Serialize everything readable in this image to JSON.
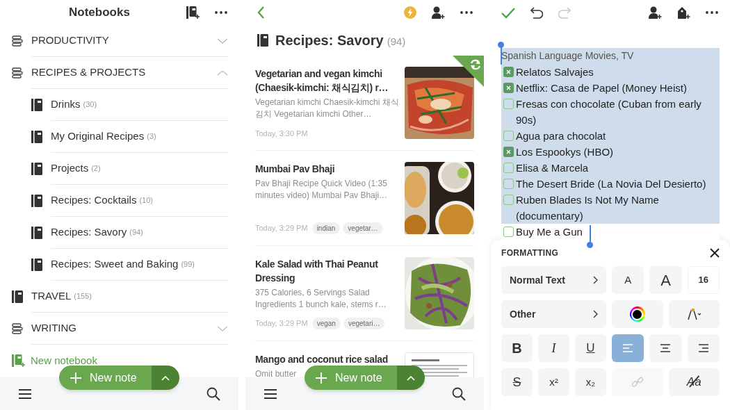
{
  "notebooks_screen": {
    "title": "Notebooks",
    "items": [
      {
        "kind": "stack",
        "label": "PRODUCTIVITY",
        "expanded": false
      },
      {
        "kind": "stack",
        "label": "RECIPES & PROJECTS",
        "expanded": true,
        "children": [
          {
            "label": "Drinks",
            "count": "(30)"
          },
          {
            "label": "My Original Recipes",
            "count": "(3)"
          },
          {
            "label": "Projects",
            "count": "(2)"
          },
          {
            "label": "Recipes: Cocktails",
            "count": "(10)"
          },
          {
            "label": "Recipes: Savory",
            "count": "(94)"
          },
          {
            "label": "Recipes: Sweet and Baking",
            "count": "(99)"
          }
        ]
      },
      {
        "kind": "notebook",
        "label": "TRAVEL",
        "count": "(155)"
      },
      {
        "kind": "stack",
        "label": "WRITING",
        "expanded": false
      }
    ],
    "new_notebook": "New notebook",
    "new_note": "New note"
  },
  "notes_screen": {
    "notebook": "Recipes: Savory",
    "count": "(94)",
    "new_note": "New note",
    "notes": [
      {
        "title": "Vegetarian and vegan kimchi (Chaesik-kimchi: 채식김치) r…",
        "snippet": "Vegetarian kimchi Chaesik-kimchi 채식김치 Vegetarian kimchi Other…",
        "date": "Today, 3:30 PM",
        "kind": "picture",
        "sync_badge": true
      },
      {
        "title": "Mumbai Pav Bhaji",
        "snippet": "Pav Bhaji Recipe Quick Video (1:35 minutes video) Mumbai Pav Bhaji…",
        "date": "Today, 3:29 PM",
        "tags": [
          "indian",
          "vegetar…"
        ],
        "kind": "picture",
        "sync_badge": false
      },
      {
        "title": "Kale Salad with Thai Peanut Dressing",
        "snippet": "375 Calories, 6 Servings Salad Ingredients 1 bunch kale, stems r…",
        "date": "Today, 3:29 PM",
        "tags": [
          "vegan",
          "vegetari…"
        ],
        "kind": "picture",
        "sync_badge": false
      },
      {
        "title": "Mango and coconut rice salad",
        "snippet": "Omit butter",
        "kind": "document",
        "sync_badge": false
      }
    ]
  },
  "editor_screen": {
    "redo_disabled": true,
    "items": [
      {
        "kind": "heading",
        "text": "Spanish Language Movies, TV",
        "selected": true
      },
      {
        "kind": "check",
        "text": "Relatos Salvajes",
        "checked": true,
        "selected": true
      },
      {
        "kind": "check",
        "text": "Netflix: Casa de Papel (Money Heist)",
        "checked": true,
        "selected": true
      },
      {
        "kind": "check",
        "text": "Fresas con chocolate (Cuban from early 90s)",
        "checked": false,
        "selected": true
      },
      {
        "kind": "check",
        "text": "Agua para chocolat",
        "checked": false,
        "selected": true
      },
      {
        "kind": "check",
        "text": "Los Espookys (HBO)",
        "checked": true,
        "selected": true
      },
      {
        "kind": "check",
        "text": "Elisa & Marcela",
        "checked": false,
        "selected": true
      },
      {
        "kind": "check",
        "text": "The Desert Bride (La Novia Del Desierto)",
        "checked": false,
        "selected": true
      },
      {
        "kind": "check",
        "text": "Ruben Blades Is Not My Name (documentary)",
        "checked": false,
        "selected": true
      },
      {
        "kind": "check",
        "text": "Buy Me a Gun",
        "checked": false,
        "selected": false
      }
    ],
    "formatting": {
      "title": "FORMATTING",
      "style": "Normal Text",
      "other": "Other",
      "size": "16",
      "size_buttons": [
        {
          "kind": "smaller",
          "glyph": "A"
        },
        {
          "kind": "larger",
          "glyph": "A"
        }
      ],
      "marks": [
        {
          "kind": "bold",
          "glyph": "B"
        },
        {
          "kind": "italic",
          "glyph": "I"
        },
        {
          "kind": "underline",
          "glyph": "U"
        }
      ],
      "alignments": [
        {
          "kind": "left",
          "selected": true
        },
        {
          "kind": "center",
          "selected": false
        },
        {
          "kind": "right",
          "selected": false
        }
      ],
      "scripts": [
        {
          "kind": "strikethrough",
          "glyph": "S"
        },
        {
          "kind": "superscript",
          "glyph": "x²"
        },
        {
          "kind": "subscript",
          "glyph": "x₂"
        }
      ],
      "link_disabled": true,
      "clear_glyph": "Aa"
    }
  }
}
